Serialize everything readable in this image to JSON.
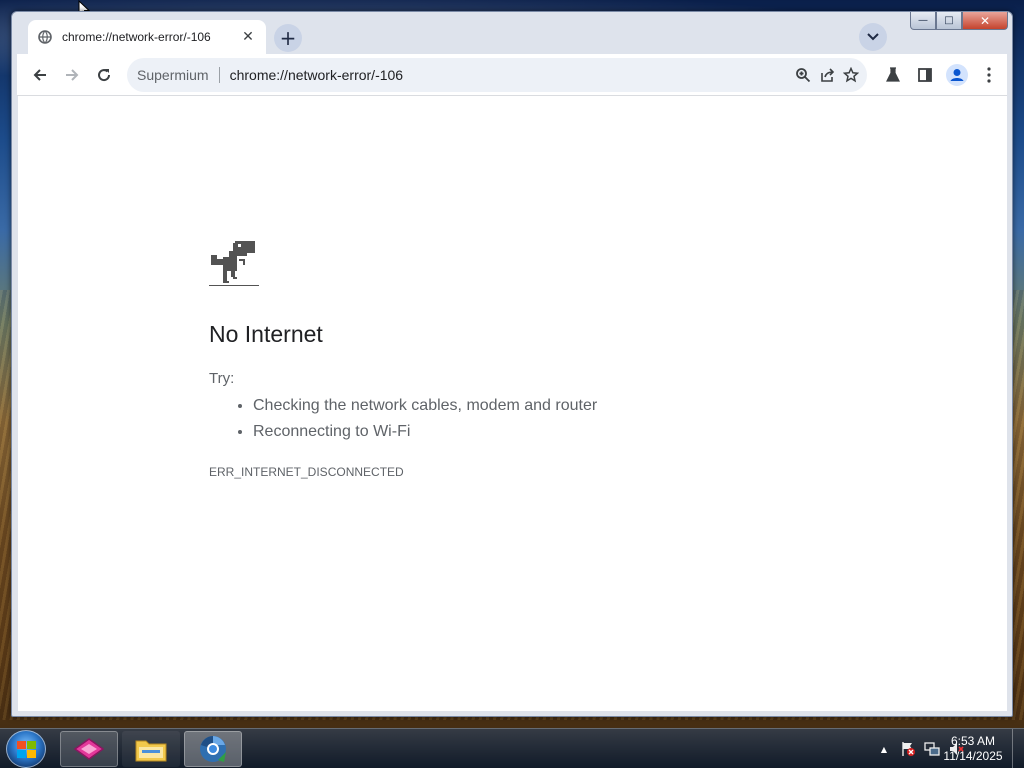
{
  "browser": {
    "tab": {
      "title": "chrome://network-error/-106",
      "close_glyph": "✕"
    },
    "new_tab_glyph": "+",
    "omnibox": {
      "site_label": "Supermium",
      "url": "chrome://network-error/-106"
    },
    "window_controls": {
      "minimize": "—",
      "maximize": "□",
      "close": "✕"
    }
  },
  "error_page": {
    "title": "No Internet",
    "try_label": "Try:",
    "suggestions": [
      "Checking the network cables, modem and router",
      "Reconnecting to Wi-Fi"
    ],
    "error_code": "ERR_INTERNET_DISCONNECTED"
  },
  "taskbar": {
    "apps": [
      "app-icon",
      "folder-icon",
      "chromium-browser-icon"
    ],
    "clock": {
      "time": "6:53 AM",
      "date": "11/14/2025"
    },
    "tray_expand_glyph": "▲"
  },
  "colors": {
    "accent": "#1a73e8",
    "text_primary": "#202124",
    "text_secondary": "#5f6368"
  }
}
